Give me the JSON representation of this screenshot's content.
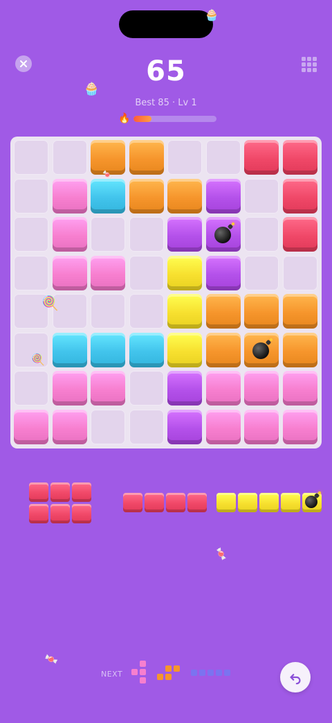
{
  "header": {
    "score": "65",
    "subtitle": "Best 85 · Lv 1",
    "streak_progress": 0.22
  },
  "colors": {
    "orange": "#f6952c",
    "red": "#f04868",
    "pink": "#f77fcf",
    "blue": "#42c4ec",
    "purple": "#b451ea",
    "yellow": "#f7e02f",
    "background": "#a05ae6"
  },
  "board": {
    "rows": [
      [
        "",
        "",
        "orange",
        "orange",
        "",
        "",
        "red",
        "red"
      ],
      [
        "",
        "pink",
        "blue",
        "orange",
        "orange",
        "purple",
        "",
        "red"
      ],
      [
        "",
        "pink",
        "",
        "",
        "purple",
        "purple:bomb",
        "",
        "red"
      ],
      [
        "",
        "pink",
        "pink",
        "",
        "yellow",
        "purple",
        "",
        ""
      ],
      [
        "",
        "",
        "",
        "",
        "yellow",
        "orange",
        "orange",
        "orange"
      ],
      [
        "",
        "blue",
        "blue",
        "blue",
        "yellow",
        "orange",
        "orange:bomb",
        "orange"
      ],
      [
        "",
        "pink",
        "pink",
        "",
        "purple",
        "pink",
        "pink",
        "pink"
      ],
      [
        "pink",
        "pink",
        "",
        "",
        "purple",
        "pink",
        "pink",
        "pink"
      ]
    ]
  },
  "tray": {
    "pieces": [
      {
        "name": "red-2x3",
        "color": "red",
        "shape": [
          [
            1,
            1,
            1
          ],
          [
            1,
            1,
            1
          ]
        ]
      },
      {
        "name": "red-1x4",
        "color": "red",
        "shape": [
          [
            1,
            1,
            1,
            1
          ]
        ]
      },
      {
        "name": "yellow-1x5",
        "color": "yellow",
        "shape": [
          [
            1,
            1,
            1,
            1,
            2
          ]
        ]
      }
    ]
  },
  "next": {
    "label": "NEXT",
    "pieces": [
      {
        "color": "#f77fcf",
        "shape": [
          [
            0,
            1
          ],
          [
            1,
            1
          ],
          [
            0,
            1
          ]
        ]
      },
      {
        "color": "#f6952c",
        "shape": [
          [
            0,
            1,
            1
          ],
          [
            1,
            1,
            0
          ]
        ]
      },
      {
        "color": "#7b73f0",
        "shape": [
          [
            1,
            1,
            1,
            1,
            1
          ]
        ]
      }
    ]
  },
  "icons": {
    "close": "close-icon",
    "menu": "grid-menu-icon",
    "undo": "undo-icon",
    "streak": "fire-icon"
  }
}
